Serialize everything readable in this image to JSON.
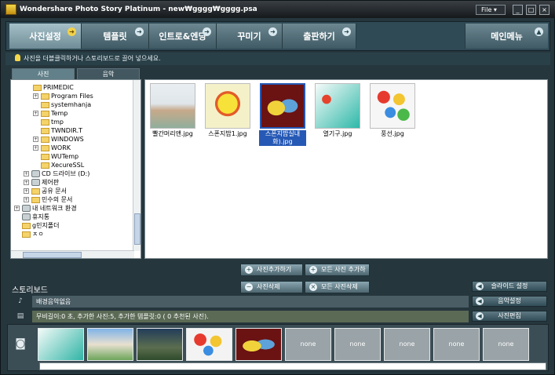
{
  "window": {
    "title": "Wondershare Photo Story Platinum - new₩gggg₩gggg.psa",
    "file_menu": "File ▾",
    "minimize": "_",
    "maximize": "□",
    "close": "×"
  },
  "nav": {
    "tabs": [
      {
        "label": "사진설정",
        "arrow": "➜"
      },
      {
        "label": "템플릿",
        "arrow": "➜"
      },
      {
        "label": "인트로&엔딩",
        "arrow": "➜"
      },
      {
        "label": "꾸미기",
        "arrow": "➜"
      },
      {
        "label": "출판하기",
        "arrow": "➜"
      },
      {
        "label": "메인메뉴",
        "arrow": "▲"
      }
    ]
  },
  "hint": "사진을 더블클릭하거나 스토리보드로 끌어 넣으세요.",
  "subtabs": [
    "사진",
    "음악"
  ],
  "tree": [
    {
      "label": "PRIMEDIC",
      "exp": ""
    },
    {
      "label": "Program Files",
      "exp": "+"
    },
    {
      "label": "systemhanja",
      "exp": ""
    },
    {
      "label": "Temp",
      "exp": "+"
    },
    {
      "label": "tmp",
      "exp": ""
    },
    {
      "label": "TWNDIR.T",
      "exp": ""
    },
    {
      "label": "WINDOWS",
      "exp": "+"
    },
    {
      "label": "WORK",
      "exp": "+"
    },
    {
      "label": "WUTemp",
      "exp": ""
    },
    {
      "label": "XecureSSL",
      "exp": ""
    },
    {
      "label": "CD 드라이브 (D:)",
      "exp": "+"
    },
    {
      "label": "제어판",
      "exp": "+"
    },
    {
      "label": "공유 문서",
      "exp": "+"
    },
    {
      "label": "민수의 문서",
      "exp": "+"
    },
    {
      "label": "내 네트워크 환경",
      "exp": "+"
    },
    {
      "label": "휴지통",
      "exp": ""
    },
    {
      "label": "g민지폴더",
      "exp": ""
    },
    {
      "label": "ㅈㅇ",
      "exp": ""
    }
  ],
  "gallery": [
    {
      "caption": "빨간머리앤.jpg"
    },
    {
      "caption": "스폰지밥1.jpg"
    },
    {
      "caption": "스폰지밥실내화).jpg"
    },
    {
      "caption": "열기구.jpg"
    },
    {
      "caption": "풍선.jpg"
    }
  ],
  "actions": {
    "add_photo": "사진추가하기",
    "add_all": "모든 사진 추가하",
    "delete_photo": "사진삭제",
    "delete_all": "모든 사진삭제"
  },
  "storyboard": {
    "title": "스토리보드",
    "music_row": "배경음악없음",
    "info_row": "무비길이:0 초,   추가한 사진:5,   추가한 템플릿:0  ( 0 추천된 사진).",
    "slide_setting": "슬라이드 설정",
    "music_setting": "음악설정",
    "photo_edit": "사진편집",
    "slots": [
      "",
      "",
      "",
      "",
      "",
      "none",
      "none",
      "none",
      "none",
      "none"
    ]
  },
  "colors": {
    "accent": "#f2d24a",
    "selection": "#2659b5"
  }
}
